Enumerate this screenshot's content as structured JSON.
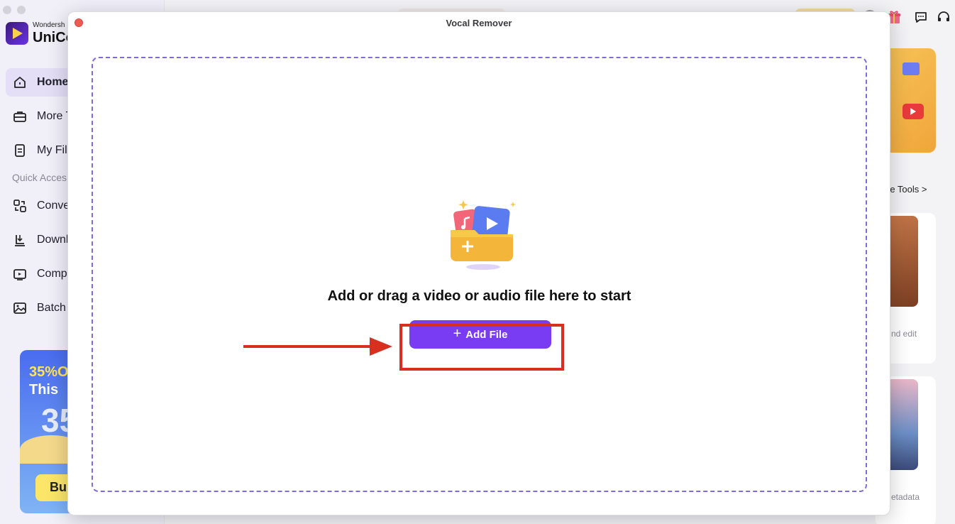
{
  "background_app": {
    "brand_small": "Wondersh",
    "brand_big": "UniCo",
    "nav": [
      {
        "label": "Home",
        "icon": "home-icon",
        "active": true
      },
      {
        "label": "More T",
        "icon": "toolbox-icon"
      },
      {
        "label": "My Fil",
        "icon": "file-icon"
      }
    ],
    "quick_access_label": "Quick Acces",
    "quick": [
      {
        "label": "Conve",
        "icon": "convert-icon"
      },
      {
        "label": "Downl",
        "icon": "download-icon"
      },
      {
        "label": "Comp",
        "icon": "compress-icon"
      },
      {
        "label": "Batch",
        "icon": "image-icon"
      }
    ],
    "promo": {
      "line1": "35%O",
      "line2": "This",
      "big": "35",
      "button": "Bu"
    },
    "right_panel": {
      "more_tools": "re Tools >",
      "caption1": "nd edit",
      "caption2": "etadata"
    }
  },
  "modal": {
    "title": "Vocal Remover",
    "drop_text": "Add or drag a video or audio file here to start",
    "add_file_label": "Add File",
    "plus_icon": "+"
  },
  "colors": {
    "accent": "#7a3cf3",
    "dash_border": "#7d6cd9",
    "annotation_red": "#d8301f",
    "close_red": "#ee5b52"
  }
}
